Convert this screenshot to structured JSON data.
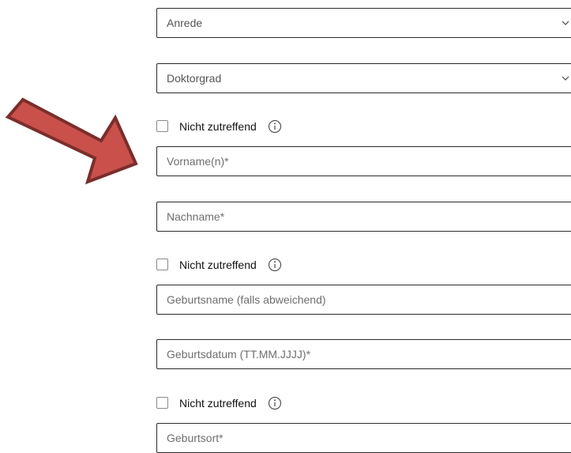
{
  "form": {
    "salutation": {
      "label": "Anrede"
    },
    "doctorate": {
      "label": "Doktorgrad"
    },
    "not_applicable_label": "Nicht zutreffend",
    "first_name": {
      "placeholder": "Vorname(n)*"
    },
    "last_name": {
      "placeholder": "Nachname*"
    },
    "birth_name": {
      "placeholder": "Geburtsname (falls abweichend)"
    },
    "birth_date": {
      "placeholder": "Geburtsdatum (TT.MM.JJJJ)*"
    },
    "birth_place": {
      "placeholder": "Geburtsort*"
    }
  },
  "annotation": {
    "arrow_color": "#c9504b",
    "arrow_border": "#7a2e2b"
  },
  "icons": {
    "chevron": "chevron-down-icon",
    "info": "info-icon"
  }
}
